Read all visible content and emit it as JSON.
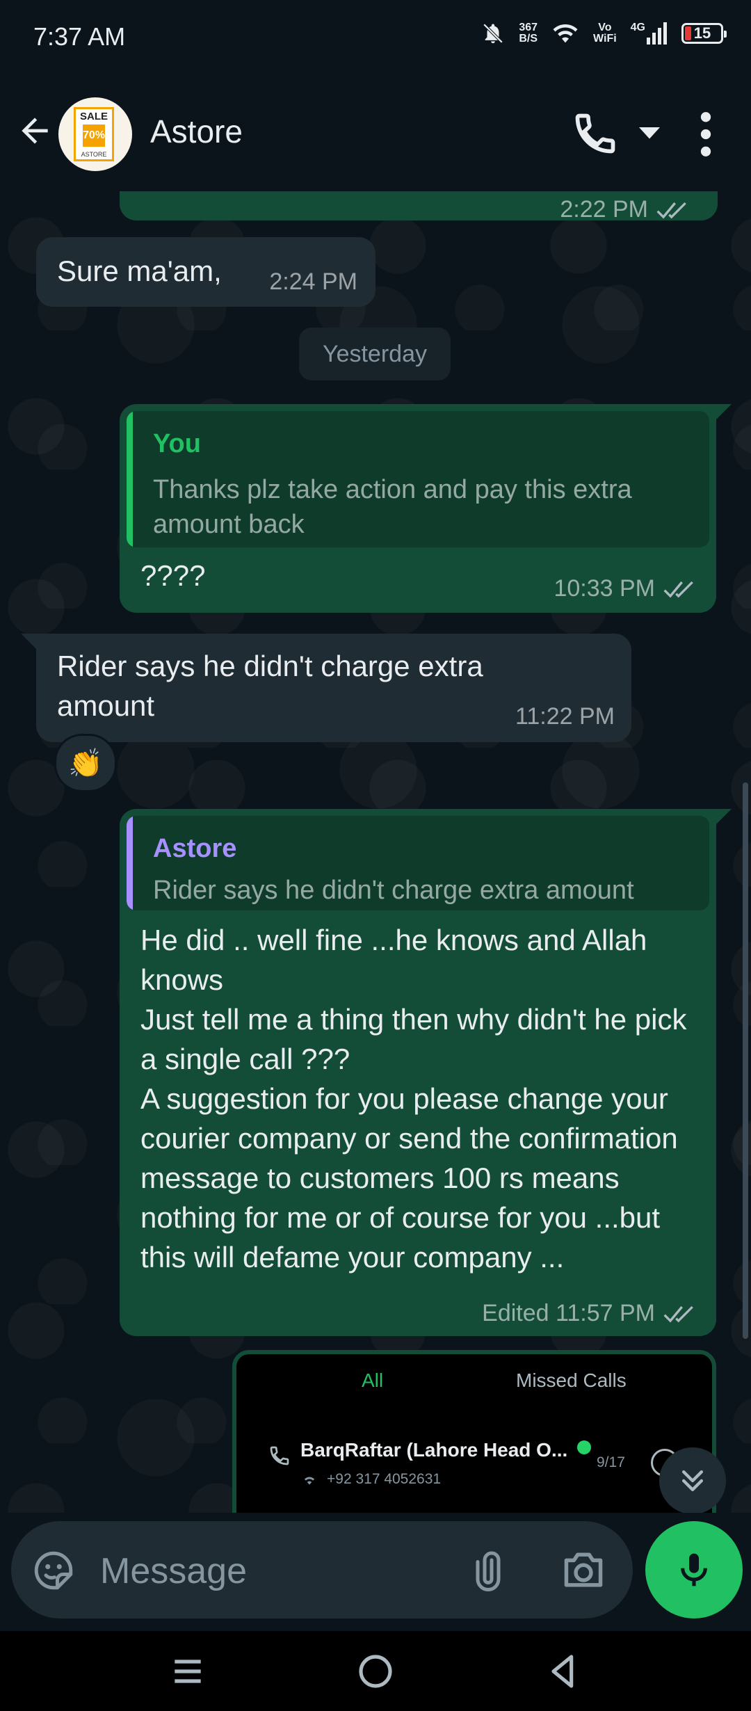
{
  "status_bar": {
    "time": "7:37 AM",
    "net_speed_value": "367",
    "net_speed_unit": "B/S",
    "vowifi_top": "Vo",
    "vowifi_bottom": "WiFi",
    "network": "4G",
    "battery": "15"
  },
  "header": {
    "contact_name": "Astore",
    "avatar_text": "SALE",
    "avatar_percent": "70%",
    "avatar_brand": "ASTORE"
  },
  "messages": {
    "m0": {
      "time": "2:22 PM"
    },
    "m1": {
      "text": "Sure ma'am,",
      "time": "2:24 PM"
    },
    "date_chip": "Yesterday",
    "m2": {
      "quote_author": "You",
      "quote_text": "Thanks plz take action and pay this extra amount back",
      "text": "????",
      "time": "10:33 PM"
    },
    "m3": {
      "text": "Rider says he didn't charge extra amount",
      "time": "11:22 PM",
      "reaction": "👏"
    },
    "m4": {
      "quote_author": "Astore",
      "quote_text": "Rider says he didn't charge extra amount",
      "text": "He did .. well fine ...he knows and Allah knows\nJust tell me a thing then why didn't he pick a single call ???\nA suggestion for you please change your courier company or send the confirmation message to customers 100 rs means nothing for me or of course for you ...but this will defame your company ...",
      "time": "Edited 11:57 PM"
    },
    "m5": {
      "tab_all": "All",
      "tab_missed": "Missed Calls",
      "caller": "BarqRaftar (Lahore Head O...",
      "number": "+92 317 4052631",
      "date": "9/17"
    }
  },
  "input": {
    "placeholder": "Message"
  },
  "colors": {
    "outgoing_bubble": "#144d37",
    "incoming_bubble": "#202c33",
    "accent_green": "#21c063",
    "quote_you_bar": "#21c063",
    "quote_astore_bar": "#a791ff"
  }
}
